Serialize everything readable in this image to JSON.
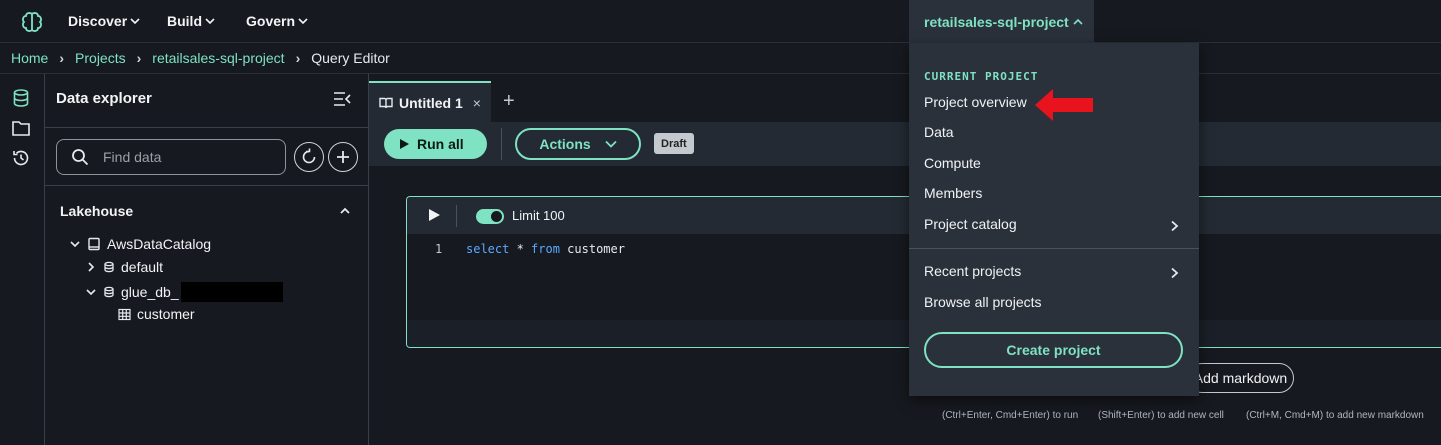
{
  "topnav": {
    "items": [
      {
        "label": "Discover"
      },
      {
        "label": "Build"
      },
      {
        "label": "Govern"
      }
    ],
    "project_switch": "retailsales-sql-project"
  },
  "breadcrumb": {
    "items": [
      "Home",
      "Projects",
      "retailsales-sql-project"
    ],
    "current": "Query Editor"
  },
  "explorer": {
    "title": "Data explorer",
    "search_placeholder": "Find data",
    "section": "Lakehouse",
    "tree": {
      "catalog": "AwsDataCatalog",
      "db_default": "default",
      "db_glue": "glue_db_",
      "table": "customer"
    }
  },
  "editor": {
    "tab_label": "Untitled 1",
    "tab_close": "×",
    "tab_add": "+",
    "run_all": "Run all",
    "actions": "Actions",
    "draft": "Draft",
    "limit_label": "Limit 100",
    "line_number": "1",
    "code": {
      "kw1": "select",
      "star": " * ",
      "kw2": "from",
      "rest": " customer"
    },
    "add_markdown": "Add markdown",
    "hints": [
      "(Ctrl+Enter, Cmd+Enter) to run",
      "(Shift+Enter) to add new cell",
      "(Ctrl+M, Cmd+M) to add new markdown"
    ]
  },
  "dropdown": {
    "section_label": "CURRENT PROJECT",
    "items": [
      "Project overview",
      "Data",
      "Compute",
      "Members",
      "Project catalog"
    ],
    "recent_projects": "Recent projects",
    "browse_all": "Browse all projects",
    "create_project": "Create project"
  },
  "colors": {
    "accent": "#7ee2c3",
    "background": "#16191f",
    "panel": "#2a313b",
    "annotation_arrow": "#e8131d"
  }
}
